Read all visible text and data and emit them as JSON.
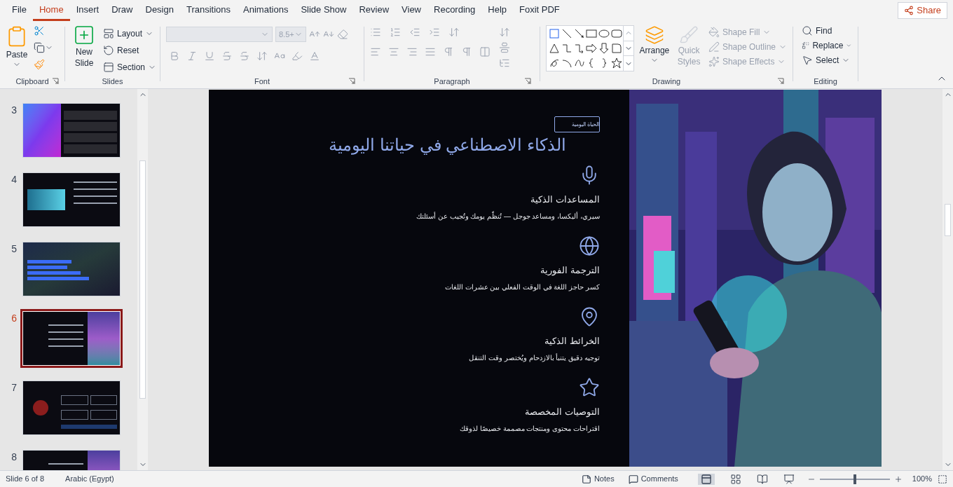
{
  "menu_tabs": [
    {
      "label": "File",
      "selected": false
    },
    {
      "label": "Home",
      "selected": true
    },
    {
      "label": "Insert",
      "selected": false
    },
    {
      "label": "Draw",
      "selected": false
    },
    {
      "label": "Design",
      "selected": false
    },
    {
      "label": "Transitions",
      "selected": false
    },
    {
      "label": "Animations",
      "selected": false
    },
    {
      "label": "Slide Show",
      "selected": false
    },
    {
      "label": "Review",
      "selected": false
    },
    {
      "label": "View",
      "selected": false
    },
    {
      "label": "Recording",
      "selected": false
    },
    {
      "label": "Help",
      "selected": false
    },
    {
      "label": "Foxit PDF",
      "selected": false
    }
  ],
  "share_button": "Share",
  "ribbon": {
    "clipboard": {
      "name": "Clipboard",
      "paste": "Paste"
    },
    "slides": {
      "name": "Slides",
      "new_slide": "New Slide",
      "commands": [
        "Layout",
        "Reset",
        "Section"
      ]
    },
    "font": {
      "name": "Font",
      "font_size": "8.5+",
      "disabled": true
    },
    "paragraph": {
      "name": "Paragraph"
    },
    "drawing": {
      "name": "Drawing",
      "arrange": "Arrange",
      "quick_styles": {
        "label": "Quick Styles",
        "disabled": true
      },
      "shape_commands": [
        {
          "label": "Shape Fill",
          "disabled": true
        },
        {
          "label": "Shape Outline",
          "disabled": true
        },
        {
          "label": "Shape Effects",
          "disabled": true
        }
      ]
    },
    "editing": {
      "name": "Editing",
      "commands": [
        "Find",
        "Replace",
        "Select"
      ]
    }
  },
  "slide_thumbnails": [
    {
      "number": "3",
      "selected": false,
      "kind": "image_left"
    },
    {
      "number": "4",
      "selected": false,
      "kind": "image_inset"
    },
    {
      "number": "5",
      "selected": false,
      "kind": "chart"
    },
    {
      "number": "6",
      "selected": true,
      "kind": "image_right"
    },
    {
      "number": "7",
      "selected": false,
      "kind": "cards"
    },
    {
      "number": "8",
      "selected": false,
      "kind": "image_right"
    }
  ],
  "slide": {
    "tag": "الحياة اليومية",
    "title": "الذكاء الاصطناعي في حياتنا اليومية",
    "features": [
      {
        "kind": "mic",
        "heading": "المساعدات الذكية",
        "text": "سيري، أليكسا، ومساعد جوجل — تُنظّم يومك وتُجيب عن أسئلتك"
      },
      {
        "kind": "globe",
        "heading": "الترجمة الفورية",
        "text": "كسر حاجز اللغة في الوقت الفعلي بين عشرات اللغات"
      },
      {
        "kind": "pin",
        "heading": "الخرائط الذكية",
        "text": "توجيه دقيق يتنبأ بالازدحام ويُختصر وقت التنقل"
      },
      {
        "kind": "star",
        "heading": "التوصيات المخصصة",
        "text": "اقتراحات محتوى ومنتجات مصممة خصيصًا لذوقك"
      }
    ]
  },
  "status_bar": {
    "slide_info": "Slide 6 of 8",
    "language": "Arabic (Egypt)",
    "notes": "Notes",
    "comments": "Comments",
    "zoom": "100%",
    "zoom_slider": {
      "level": 0.5
    }
  }
}
